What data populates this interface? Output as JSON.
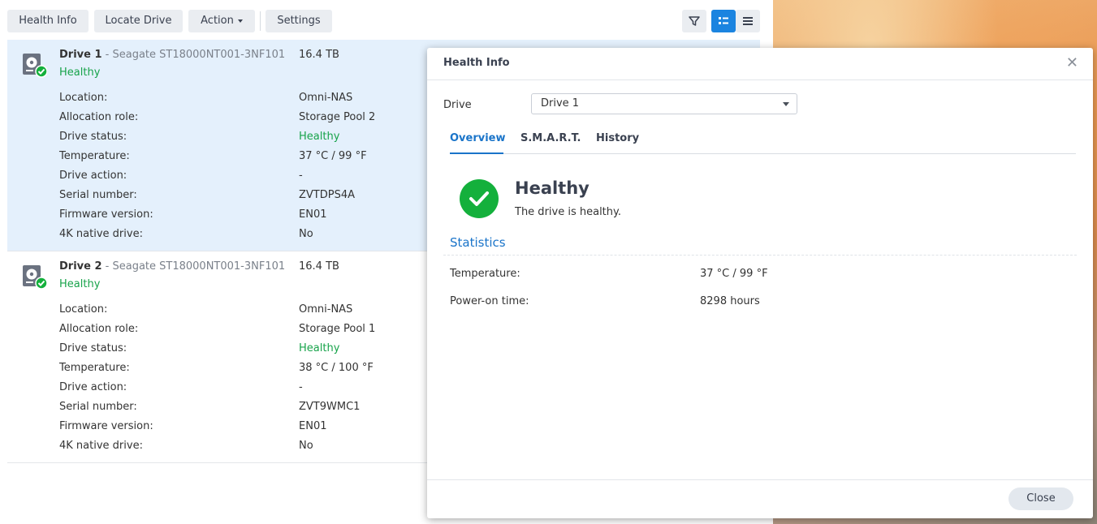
{
  "toolbar": {
    "health_info": "Health Info",
    "locate_drive": "Locate Drive",
    "action": "Action",
    "settings": "Settings",
    "icons": [
      "filter-icon",
      "detail-view-icon",
      "list-view-icon"
    ],
    "accent": "#1b84e0"
  },
  "drives": [
    {
      "name": "Drive 1",
      "model": "- Seagate ST18000NT001-3NF101",
      "capacity": "16.4 TB",
      "health": "Healthy",
      "labels": {
        "location": "Location:",
        "allocation": "Allocation role:",
        "status": "Drive status:",
        "temperature": "Temperature:",
        "action": "Drive action:",
        "serial": "Serial number:",
        "firmware": "Firmware version:",
        "native4k": "4K native drive:"
      },
      "values": {
        "location": "Omni-NAS",
        "allocation": "Storage Pool 2",
        "status": "Healthy",
        "temperature": "37 °C / 99 °F",
        "action": "-",
        "serial": "ZVTDPS4A",
        "firmware": "EN01",
        "native4k": "No"
      }
    },
    {
      "name": "Drive 2",
      "model": "- Seagate ST18000NT001-3NF101",
      "capacity": "16.4 TB",
      "health": "Healthy",
      "labels": {
        "location": "Location:",
        "allocation": "Allocation role:",
        "status": "Drive status:",
        "temperature": "Temperature:",
        "action": "Drive action:",
        "serial": "Serial number:",
        "firmware": "Firmware version:",
        "native4k": "4K native drive:"
      },
      "values": {
        "location": "Omni-NAS",
        "allocation": "Storage Pool 1",
        "status": "Healthy",
        "temperature": "38 °C / 100 °F",
        "action": "-",
        "serial": "ZVT9WMC1",
        "firmware": "EN01",
        "native4k": "No"
      }
    }
  ],
  "dialog": {
    "title": "Health Info",
    "drive_label": "Drive",
    "drive_selected": "Drive 1",
    "tabs": [
      "Overview",
      "S.M.A.R.T.",
      "History"
    ],
    "status_title": "Healthy",
    "status_desc": "The drive is healthy.",
    "stats_heading": "Statistics",
    "stats": [
      {
        "label": "Temperature:",
        "value": "37 °C / 99 °F"
      },
      {
        "label": "Power-on time:",
        "value": "8298 hours"
      }
    ],
    "close": "Close",
    "healthy_color": "#14b03c"
  }
}
